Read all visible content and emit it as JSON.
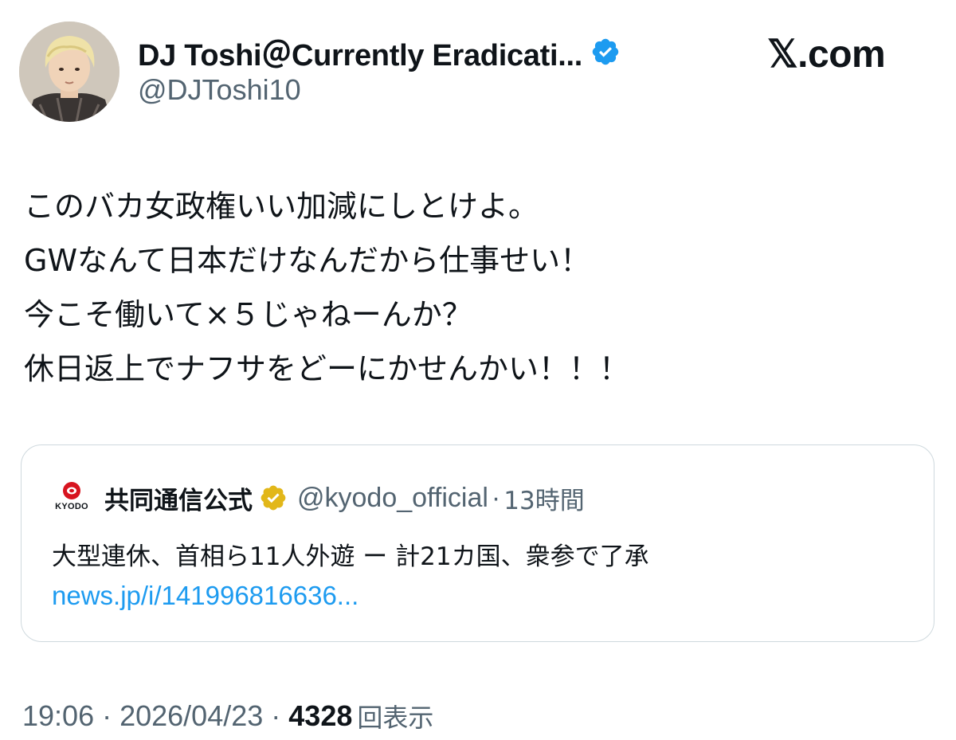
{
  "author": {
    "display_name": "DJ Toshi＠Currently Eradicati...",
    "handle": "@DJToshi10",
    "verified_badge_color": "#1d9bf0"
  },
  "brand": {
    "label": "𝕏.com"
  },
  "tweet": {
    "lines": [
      "このバカ女政権いい加減にしとけよ。",
      "GWなんて日本だけなんだから仕事せい！",
      "今こそ働いて×５じゃねーんか？",
      "休日返上でナフサをどーにかせんかい！！！"
    ]
  },
  "quote": {
    "logo_text": "KYODO",
    "name": "共同通信公式",
    "handle": "@kyodo_official",
    "separator": "·",
    "time": "13時間",
    "text": "大型連休、首相ら11人外遊 ー 計21カ国、衆参で了承",
    "link": "news.jp/i/141996816636...",
    "link_color": "#1d9bf0",
    "badge_color": "#e2b719"
  },
  "meta": {
    "time": "19:06",
    "separator": "·",
    "date": "2026/04/23",
    "views_count": "4328",
    "views_label": "回表示"
  },
  "colors": {
    "text": "#0f1419",
    "secondary": "#536471",
    "border": "#cfd9de"
  }
}
